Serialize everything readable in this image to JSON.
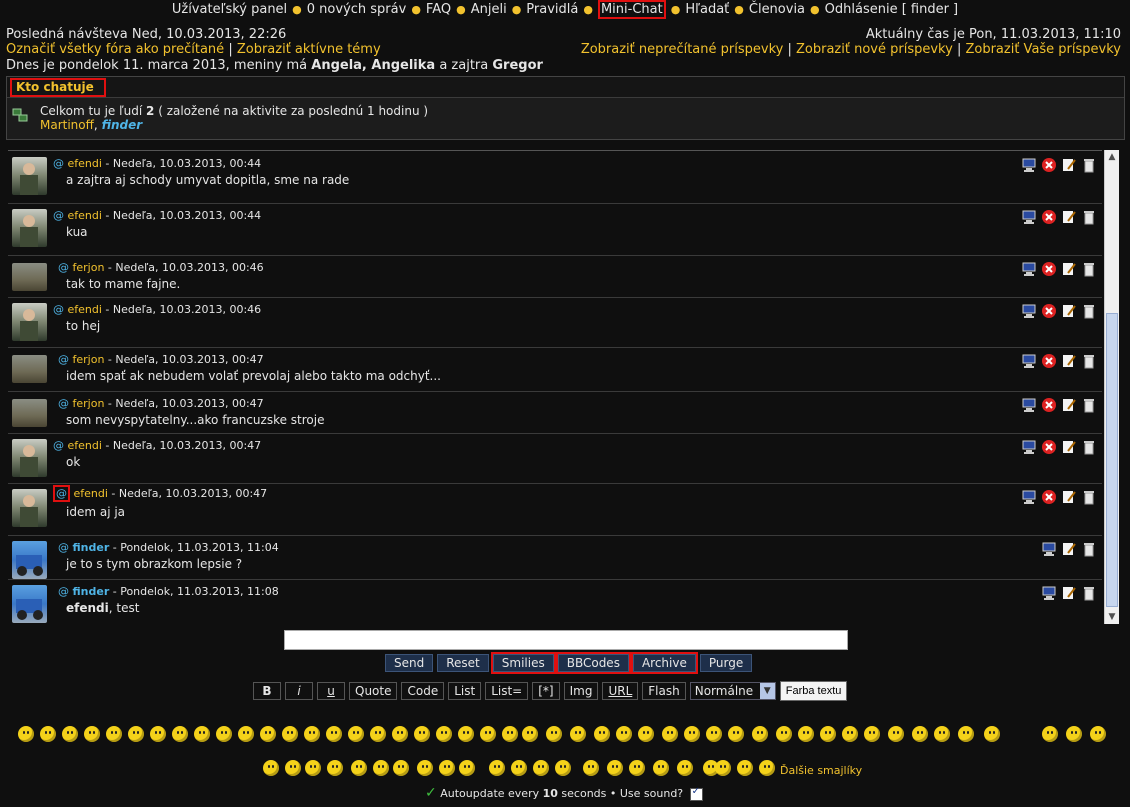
{
  "nav": {
    "items": [
      {
        "label": "Užívateľský panel"
      },
      {
        "label": "0 nových správ"
      },
      {
        "label": "FAQ"
      },
      {
        "label": "Anjeli"
      },
      {
        "label": "Pravidlá"
      },
      {
        "label": "Mini-Chat",
        "highlighted": true
      },
      {
        "label": "Hľadať"
      },
      {
        "label": "Členovia"
      },
      {
        "label": "Odhlásenie [ finder ]"
      }
    ]
  },
  "header": {
    "last_visit": "Posledná návšteva Ned, 10.03.2013, 22:26",
    "mark_read": "Označiť všetky fóra ako prečítané",
    "sep": "|",
    "active_topics": "Zobraziť aktívne témy",
    "current_time": "Aktuálny čas je Pon, 11.03.2013, 11:10",
    "unread": "Zobraziť neprečítané príspevky",
    "new_posts": "Zobraziť nové príspevky",
    "your_posts": "Zobraziť Vaše príspevky",
    "today_prefix": "Dnes je pondelok 11. marca 2013, meniny má",
    "names": "Angela, Angelika",
    "tomorrow": "a zajtra",
    "tomorrow_name": "Gregor"
  },
  "who": {
    "title": "Kto chatuje",
    "count_prefix": "Celkom tu je ľudí",
    "count": "2",
    "count_suffix": "( založené na aktivite za poslednú 1 hodinu )",
    "user1": "Martinoff",
    "comma": ",",
    "user2": "finder"
  },
  "messages": [
    {
      "user": "efendi",
      "date": "Nedeľa, 10.03.2013, 00:44",
      "text": "a zajtra aj schody umyvat dopitla, sme na rade"
    },
    {
      "user": "efendi",
      "date": "Nedeľa, 10.03.2013, 00:44",
      "text": "kua"
    },
    {
      "user": "ferjon",
      "date": "Nedeľa, 10.03.2013, 00:46",
      "text": "tak to mame fajne."
    },
    {
      "user": "efendi",
      "date": "Nedeľa, 10.03.2013, 00:46",
      "text": "to hej"
    },
    {
      "user": "ferjon",
      "date": "Nedeľa, 10.03.2013, 00:47",
      "text": "idem spať ak nebudem volať prevolaj alebo takto ma odchyť..."
    },
    {
      "user": "ferjon",
      "date": "Nedeľa, 10.03.2013, 00:47",
      "text": "som nevyspytatelny...ako francuzske stroje"
    },
    {
      "user": "efendi",
      "date": "Nedeľa, 10.03.2013, 00:47",
      "text": "ok"
    },
    {
      "user": "efendi",
      "date": "Nedeľa, 10.03.2013, 00:47",
      "text": "idem aj ja"
    },
    {
      "user": "finder",
      "date": "Pondelok, 11.03.2013, 11:04",
      "text": "je to s tym obrazkom lepsie ?"
    },
    {
      "user": "finder",
      "date": "Pondelok, 11.03.2013, 11:08",
      "text_bold": "efendi",
      "text_rest": ", test"
    }
  ],
  "at_symbol": "@",
  "dash": "-",
  "buttons": {
    "send": "Send",
    "reset": "Reset",
    "smilies": "Smilies",
    "bbcodes": "BBCodes",
    "archive": "Archive",
    "purge": "Purge"
  },
  "bbcode": {
    "b": "B",
    "i": "i",
    "u": "u",
    "quote": "Quote",
    "code": "Code",
    "list": "List",
    "list_eq": "List=",
    "star": "[*]",
    "img": "Img",
    "url": "URL",
    "flash": "Flash",
    "size": "Normálne",
    "color": "Farba textu"
  },
  "more_smilies": "Ďalšie smajlíky",
  "footer": {
    "prefix": "Autoupdate every",
    "seconds": "10",
    "suffix": "seconds • Use sound?"
  },
  "colors": {
    "accent": "#f2c22e",
    "link_blue": "#4fb4e6",
    "highlight": "#e01010",
    "bg": "#0f0f0f"
  }
}
